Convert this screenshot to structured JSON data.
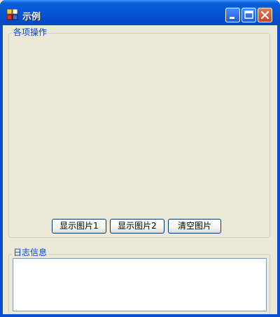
{
  "window": {
    "title": "示例"
  },
  "operations_group": {
    "label": "各项操作",
    "buttons": [
      {
        "label": "显示图片1"
      },
      {
        "label": "显示图片2"
      },
      {
        "label": "清空图片"
      }
    ]
  },
  "log_group": {
    "label": "日志信息",
    "content": ""
  }
}
